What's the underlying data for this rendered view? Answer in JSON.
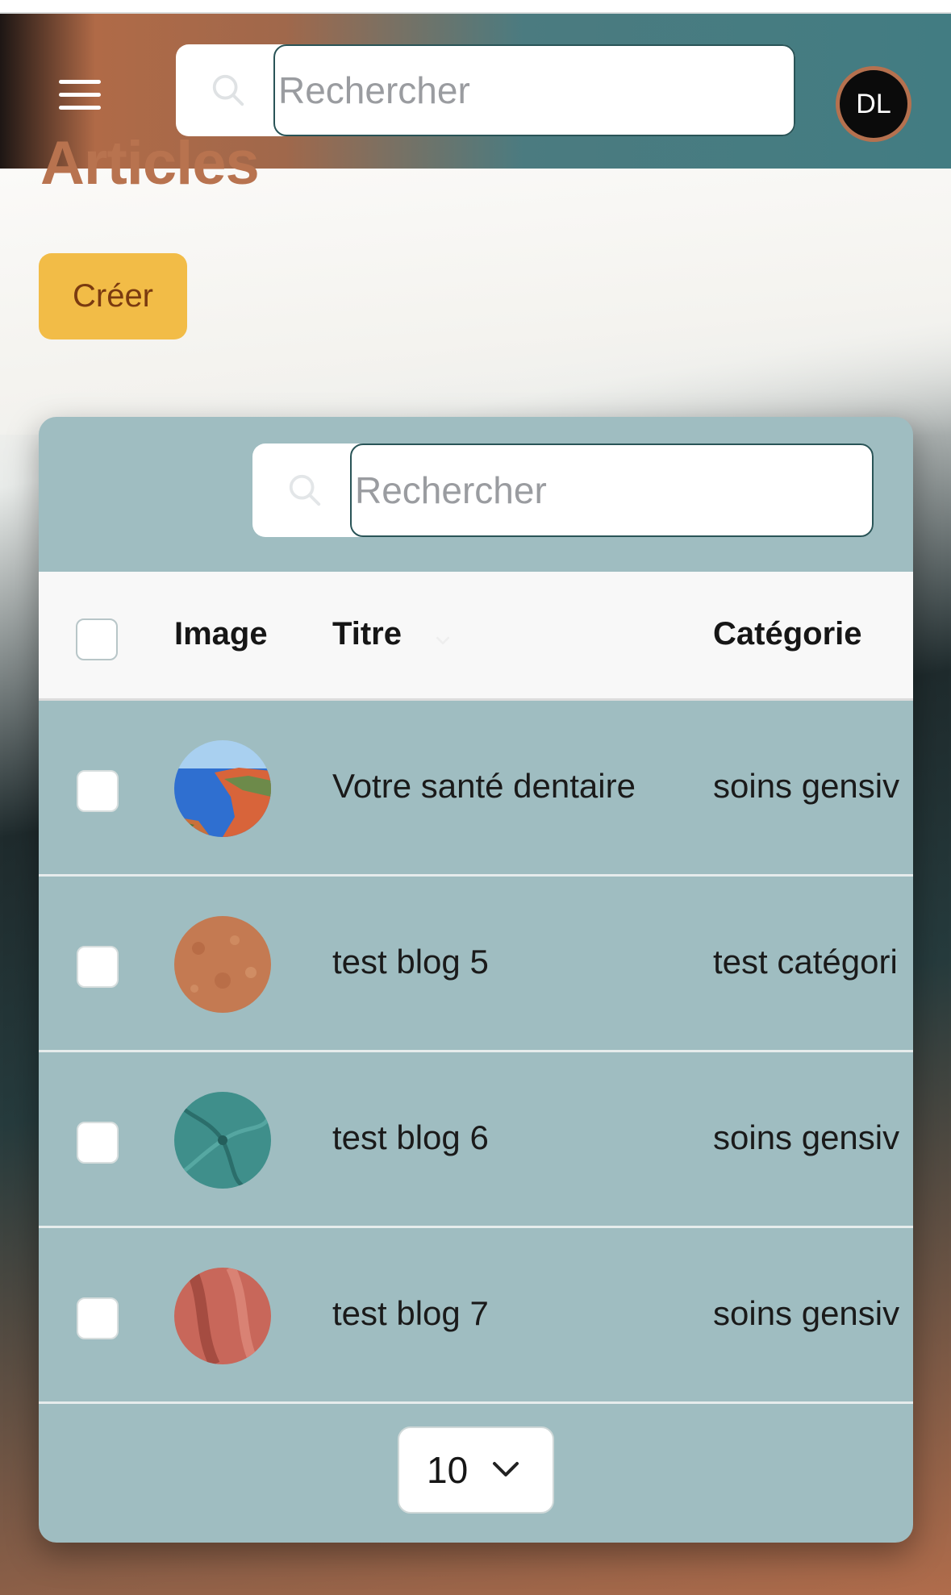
{
  "header": {
    "search_placeholder": "Rechercher",
    "avatar_initials": "DL"
  },
  "page": {
    "title": "Articles",
    "create_label": "Créer"
  },
  "table": {
    "search_placeholder": "Rechercher",
    "columns": [
      "Image",
      "Titre",
      "Catégorie"
    ],
    "rows": [
      {
        "image": "coastline-photo",
        "title": "Votre santé dentaire",
        "category": "soins gensiv"
      },
      {
        "image": "terracotta-texture",
        "title": "test blog 5",
        "category": "test catégori"
      },
      {
        "image": "teal-fabric-swirl",
        "title": "test blog 6",
        "category": "soins gensiv"
      },
      {
        "image": "rose-fabric",
        "title": "test blog 7",
        "category": "soins gensiv"
      }
    ],
    "page_size": "10"
  },
  "colors": {
    "brand_terracotta": "#b8734f",
    "header_teal": "#427c82",
    "card_bg": "#9fbdc1",
    "create_button": "#f2bc47",
    "create_text": "#7a3a10"
  },
  "icons": {
    "menu": "hamburger-icon",
    "search": "search-icon",
    "dropdown": "chevron-down-icon"
  }
}
